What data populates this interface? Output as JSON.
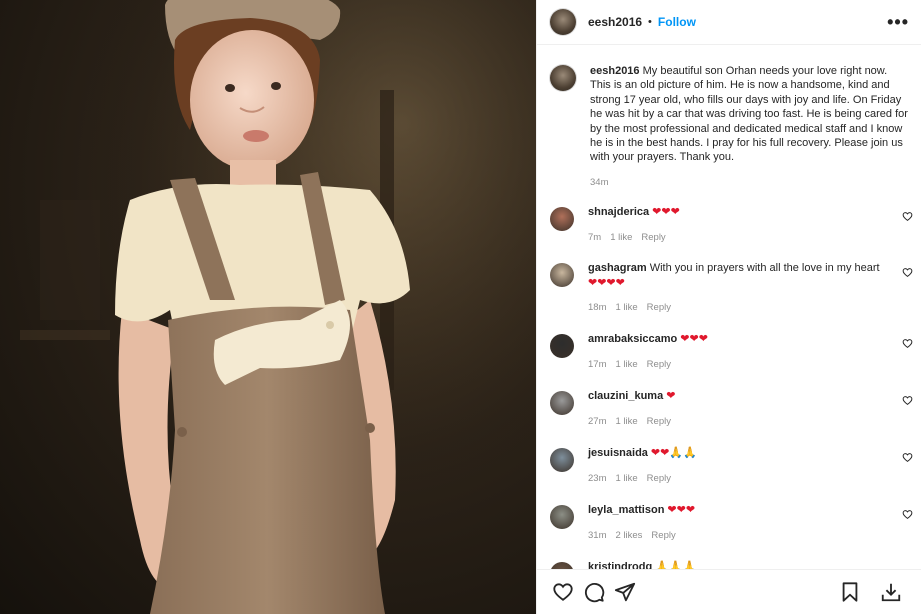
{
  "post": {
    "username": "eesh2016",
    "follow_label": "Follow",
    "dot": "•",
    "more_label": "•••",
    "caption_user": "eesh2016",
    "caption_text": "My beautiful son Orhan needs your love right now. This is an old picture of him. He is now a handsome, kind and strong 17 year old, who fills our days with joy and life. On Friday he was hit by a car that was driving too fast. He is being cared for by the most professional and dedicated medical staff and I know he is in the best hands. I pray for his full recovery. Please join us with your prayers. Thank you.",
    "caption_time": "34m"
  },
  "comments": [
    {
      "user": "shnajderica",
      "text": "",
      "emoji": "❤❤❤",
      "time": "7m",
      "likes": "1 like",
      "reply": "Reply",
      "avatar_color": "#b0705a"
    },
    {
      "user": "gashagram",
      "text": "With you in prayers with all the love in my heart",
      "emoji": "❤❤❤❤",
      "time": "18m",
      "likes": "1 like",
      "reply": "Reply",
      "avatar_color": "#c9b79f"
    },
    {
      "user": "amrabaksiccamo",
      "text": "",
      "emoji": "❤❤❤",
      "time": "17m",
      "likes": "1 like",
      "reply": "Reply",
      "avatar_color": "#2d2d2d"
    },
    {
      "user": "clauzini_kuma",
      "text": "",
      "emoji": "❤",
      "time": "27m",
      "likes": "1 like",
      "reply": "Reply",
      "avatar_color": "#9a9a9a"
    },
    {
      "user": "jesuisnaida",
      "text": "",
      "emoji": "❤❤🙏🙏",
      "time": "23m",
      "likes": "1 like",
      "reply": "Reply",
      "avatar_color": "#7e8f9c"
    },
    {
      "user": "leyla_mattison",
      "text": "",
      "emoji": "❤❤❤",
      "time": "31m",
      "likes": "2 likes",
      "reply": "Reply",
      "avatar_color": "#8c8f86"
    },
    {
      "user": "kristindrodg",
      "text": "",
      "emoji": "🙏🙏🙏",
      "time": "",
      "likes": "",
      "reply": "",
      "avatar_color": "#6b5444"
    }
  ],
  "icons": [
    "heart-icon",
    "comment-icon",
    "share-icon",
    "bookmark-icon",
    "more-icon",
    "small-heart-icon"
  ],
  "colors": {
    "accent": "#0095f6",
    "heart": "#e0182d",
    "muted": "#8e8e8e",
    "border": "#efefef"
  }
}
